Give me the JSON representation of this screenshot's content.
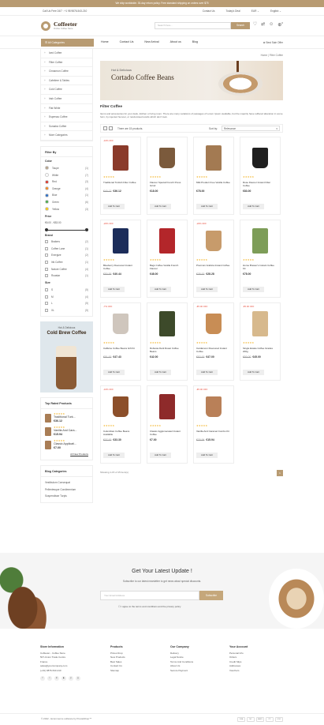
{
  "topbar": {
    "text": "We ship worldwide. 30-day return policy. Free standard shipping on orders over $75"
  },
  "util": {
    "left": "Call Us Free 24/7 : +1 98 9876-543-210",
    "contact": "Contact Us",
    "deal": "Today's Deal",
    "currency": "EUR ⌄",
    "language": "English ⌄"
  },
  "header": {
    "logo_title": "Coffeeter",
    "logo_sub": "Online Coffee Store",
    "search_placeholder": "Search here...",
    "search_btn": "Search",
    "cart_count": "0"
  },
  "nav": {
    "all_categories": "All Categories",
    "items": [
      "Home",
      "Contact Us",
      "New Arrival",
      "About us",
      "Blog"
    ],
    "best_sale": "Best Sale Offer"
  },
  "categories": [
    "Iced Coffee",
    "Filter Coffee",
    "Cinnamon Coffee",
    "Cafetiere & Tables",
    "Cold Coffee",
    "Irish Coffee",
    "Flat White",
    "Espresso Coffee",
    "Sumatra Coffee",
    "More Categories"
  ],
  "filter": {
    "title": "Filter By",
    "color_label": "Color",
    "colors": [
      {
        "name": "Taupe",
        "count": "(1)",
        "hex": "#b5a38b"
      },
      {
        "name": "White",
        "count": "(7)",
        "hex": "#ffffff"
      },
      {
        "name": "Red",
        "count": "(3)",
        "hex": "#d9342b"
      },
      {
        "name": "Orange",
        "count": "(4)",
        "hex": "#f08a24"
      },
      {
        "name": "Blue",
        "count": "(1)",
        "hex": "#2f6fc4"
      },
      {
        "name": "Green",
        "count": "(6)",
        "hex": "#4aa84b"
      },
      {
        "name": "Yellow",
        "count": "(3)",
        "hex": "#f5c518"
      }
    ],
    "price_label": "Price",
    "price_range": "€6.00 - €83.00",
    "brand_label": "Brand",
    "brands": [
      {
        "name": "Brakers",
        "count": "(2)"
      },
      {
        "name": "Coffee Lane",
        "count": "(1)"
      },
      {
        "name": "Energize",
        "count": "(2)"
      },
      {
        "name": "Irik Coffee",
        "count": "(1)"
      },
      {
        "name": "Nature Coffee",
        "count": "(4)"
      },
      {
        "name": "Roastar",
        "count": "(1)"
      }
    ],
    "size_label": "Size",
    "sizes": [
      {
        "name": "S",
        "count": "(5)"
      },
      {
        "name": "M",
        "count": "(4)"
      },
      {
        "name": "L",
        "count": "(5)"
      },
      {
        "name": "XL",
        "count": "(5)"
      }
    ]
  },
  "promo": {
    "kicker": "Hot & Delicious",
    "title": "Cold Brew Coffee"
  },
  "top_rated": {
    "title": "Top Rated Products",
    "items": [
      {
        "name": "Traditional Turk...",
        "price": "€36.12"
      },
      {
        "name": "Vanilla And Cara...",
        "price": "€15.94"
      },
      {
        "name": "Classic Applicati...",
        "price": "€7.00"
      }
    ],
    "all_link": "All New Products"
  },
  "blog_categories": {
    "title": "Blog Categories",
    "items": [
      "Vestibulum Consequat",
      "Pellentesque Condimentum",
      "Suspendisse Turpis"
    ]
  },
  "breadcrumb": "Home | Filter Coffee",
  "banner": {
    "kicker": "Hot & Delicious",
    "title": "Cortado Coffee Beans"
  },
  "listing": {
    "title": "Filter Coffee",
    "desc": "Items and accessories for your desk, kitchen or living room. There are many variations of passages of Lorem Ipsum available, but the majority have suffered alteration in some form, by injected humour, or randomised words which don't look.",
    "count": "There are 15 products.",
    "sort_label": "Sort by:",
    "sort_value": "Relevance",
    "add_to_cart": "Add To Cart",
    "showing": "Showing 1-15 of 15 item(s)",
    "page": "1"
  },
  "products": [
    {
      "badge": "-10% OFF",
      "name": "Traditional Turkish Filter Coffee",
      "old": "€40.13",
      "price": "€36.12",
      "color": "#8a3a2a",
      "shape": "bag"
    },
    {
      "badge": "",
      "name": "Flavour Special French Press Grind",
      "old": "",
      "price": "€18.00",
      "color": "#7b5a3c",
      "shape": "cup"
    },
    {
      "badge": "",
      "name": "Milk Product Free Vanilla Coffee",
      "old": "",
      "price": "€78.00",
      "color": "#a37a52",
      "shape": "bag"
    },
    {
      "badge": "",
      "name": "Rose Flavour Instant Filter Coffee",
      "old": "",
      "price": "€83.00",
      "color": "#1f1f1f",
      "shape": "cup"
    },
    {
      "badge": "-20% OFF",
      "name": "Blueberry Flavoured Instant Coffee",
      "old": "€50.55",
      "price": "€40.44",
      "color": "#1c2d5a",
      "shape": "bag"
    },
    {
      "badge": "",
      "name": "Bags Coffee Vanilla French Flavour",
      "old": "",
      "price": "€48.00",
      "color": "#b3262a",
      "shape": "bag"
    },
    {
      "badge": "-20% OFF",
      "name": "Premium Arabica Instant Coffee",
      "old": "€35.00",
      "price": "€28.28",
      "color": "#c79b6b",
      "shape": "cup"
    },
    {
      "badge": "",
      "name": "Home Brewer's Instant Coffee Kit",
      "old": "",
      "price": "€78.00",
      "color": "#7d9d58",
      "shape": "bag"
    },
    {
      "badge": "-7% OFF",
      "name": "Caffeine Coffee Beans Gift Kit",
      "old": "€51.00",
      "price": "€47.43",
      "color": "#cfc6bd",
      "shape": "cup"
    },
    {
      "badge": "",
      "name": "Robusta Dark Roast Coffee Beans",
      "old": "",
      "price": "€42.00",
      "color": "#3d4a2a",
      "shape": "bag"
    },
    {
      "badge": "-€5.00 OFF",
      "name": "Cardamom Flavoured Instant Coffee",
      "old": "€52.00",
      "price": "€47.00",
      "color": "#c88d55",
      "shape": "cup"
    },
    {
      "badge": "-€5.00 OFF",
      "name": "Single Estate Coffee Grades 200g",
      "old": "€50.00",
      "price": "€45.00",
      "color": "#d7b98d",
      "shape": "bag"
    },
    {
      "badge": "-10% OFF",
      "name": "Columbian Coffee Beans Available",
      "old": "€37.00",
      "price": "€33.30",
      "color": "#8c4f2a",
      "shape": "cup"
    },
    {
      "badge": "",
      "name": "Classic Agglomerated Instant Coffee",
      "old": "",
      "price": "€7.00",
      "color": "#8e2a2a",
      "shape": "bag"
    },
    {
      "badge": "-€5.00 OFF",
      "name": "Vanilla And Caramel Combo Kit",
      "old": "€20.94",
      "price": "€15.94",
      "color": "#b98058",
      "shape": "cup"
    }
  ],
  "newsletter": {
    "title": "Get Your Latest Update !",
    "sub": "Subscribe to our latest newsletter to get news about special discounts.",
    "placeholder": "Your Email Address",
    "btn": "Subscribe",
    "agree": "I agree to the terms and conditions and the privacy policy"
  },
  "footer": {
    "store_title": "Store Information",
    "store_lines": [
      "Coffeeter - Coffee Store",
      "507-Union Trade Centre",
      "France",
      "sales@yourcompany.com",
      "(+91) 9876-543-210"
    ],
    "products_title": "Products",
    "products_links": [
      "Prices Drop",
      "New Products",
      "Best Sales",
      "Contact Us",
      "Sitemap"
    ],
    "company_title": "Our Company",
    "company_links": [
      "Delivery",
      "Legal Notice",
      "Terms And Conditions",
      "About Us",
      "Secure Payment"
    ],
    "account_title": "Your Account",
    "account_links": [
      "Personal Info",
      "Orders",
      "Credit Slips",
      "Addresses",
      "Vouchers"
    ],
    "social": [
      "f",
      "t",
      "in",
      "▶",
      "p",
      "◎"
    ]
  },
  "copyright": "© 2022 - Ecommerce software by PrestaShop™",
  "payments": [
    "VISA",
    "MC",
    "AMEX",
    "PP",
    "DISC"
  ]
}
